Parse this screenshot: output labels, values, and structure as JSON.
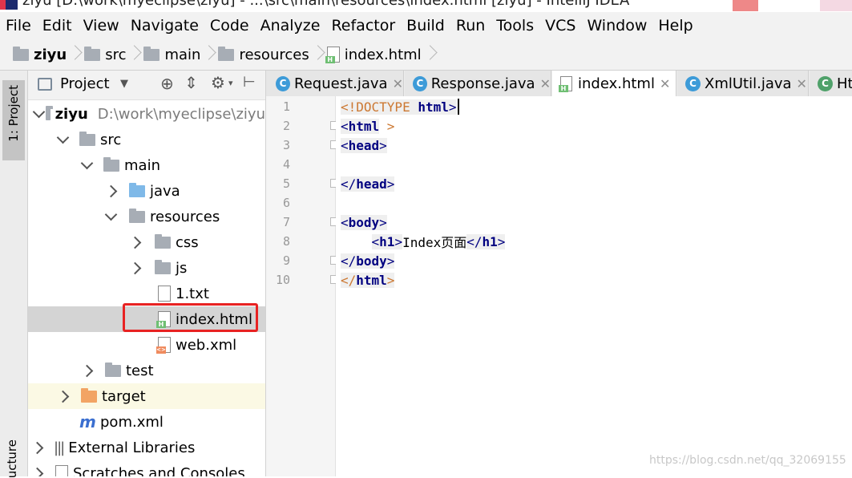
{
  "window": {
    "title": "ziyu [D:\\work\\myeclipse\\ziyu] - ...\\src\\main\\resources\\index.html [ziyu] - IntelliJ IDEA"
  },
  "menu": [
    "File",
    "Edit",
    "View",
    "Navigate",
    "Code",
    "Analyze",
    "Refactor",
    "Build",
    "Run",
    "Tools",
    "VCS",
    "Window",
    "Help"
  ],
  "breadcrumb": [
    "ziyu",
    "src",
    "main",
    "resources",
    "index.html"
  ],
  "side_tabs": {
    "project": "1: Project",
    "structure": "ucture"
  },
  "project_panel": {
    "title": "Project",
    "tree": [
      {
        "label": "ziyu",
        "path": "D:\\work\\myeclipse\\ziyu"
      },
      {
        "label": "src"
      },
      {
        "label": "main"
      },
      {
        "label": "java"
      },
      {
        "label": "resources"
      },
      {
        "label": "css"
      },
      {
        "label": "js"
      },
      {
        "label": "1.txt"
      },
      {
        "label": "index.html"
      },
      {
        "label": "web.xml"
      },
      {
        "label": "test"
      },
      {
        "label": "target"
      },
      {
        "label": "pom.xml"
      },
      {
        "label": "External Libraries"
      },
      {
        "label": "Scratches and Consoles"
      }
    ]
  },
  "tabs": [
    {
      "label": "Request.java"
    },
    {
      "label": "Response.java"
    },
    {
      "label": "index.html"
    },
    {
      "label": "XmlUtil.java"
    },
    {
      "label": "Ht"
    }
  ],
  "code": {
    "line_numbers": [
      "1",
      "2",
      "3",
      "4",
      "5",
      "6",
      "7",
      "8",
      "9",
      "10"
    ],
    "lines": {
      "l1": {
        "a": "<!DOCTYPE",
        "b": " html",
        "c": ">"
      },
      "l2": {
        "a": "<",
        "b": "html",
        "c": " >"
      },
      "l3": {
        "a": "<",
        "b": "head",
        "c": ">"
      },
      "l5": {
        "a": "</",
        "b": "head",
        "c": ">"
      },
      "l7": {
        "a": "<",
        "b": "body",
        "c": ">"
      },
      "l8": {
        "indent": "    ",
        "a": "<",
        "b": "h1",
        "c": ">",
        "text": "Index页面",
        "d": "</",
        "e": "h1",
        "f": ">"
      },
      "l9": {
        "a": "</",
        "b": "body",
        "c": ">"
      },
      "l10": {
        "a": "</",
        "b": "html",
        "c": ">"
      }
    }
  },
  "watermark": "https://blog.csdn.net/qq_32069155"
}
